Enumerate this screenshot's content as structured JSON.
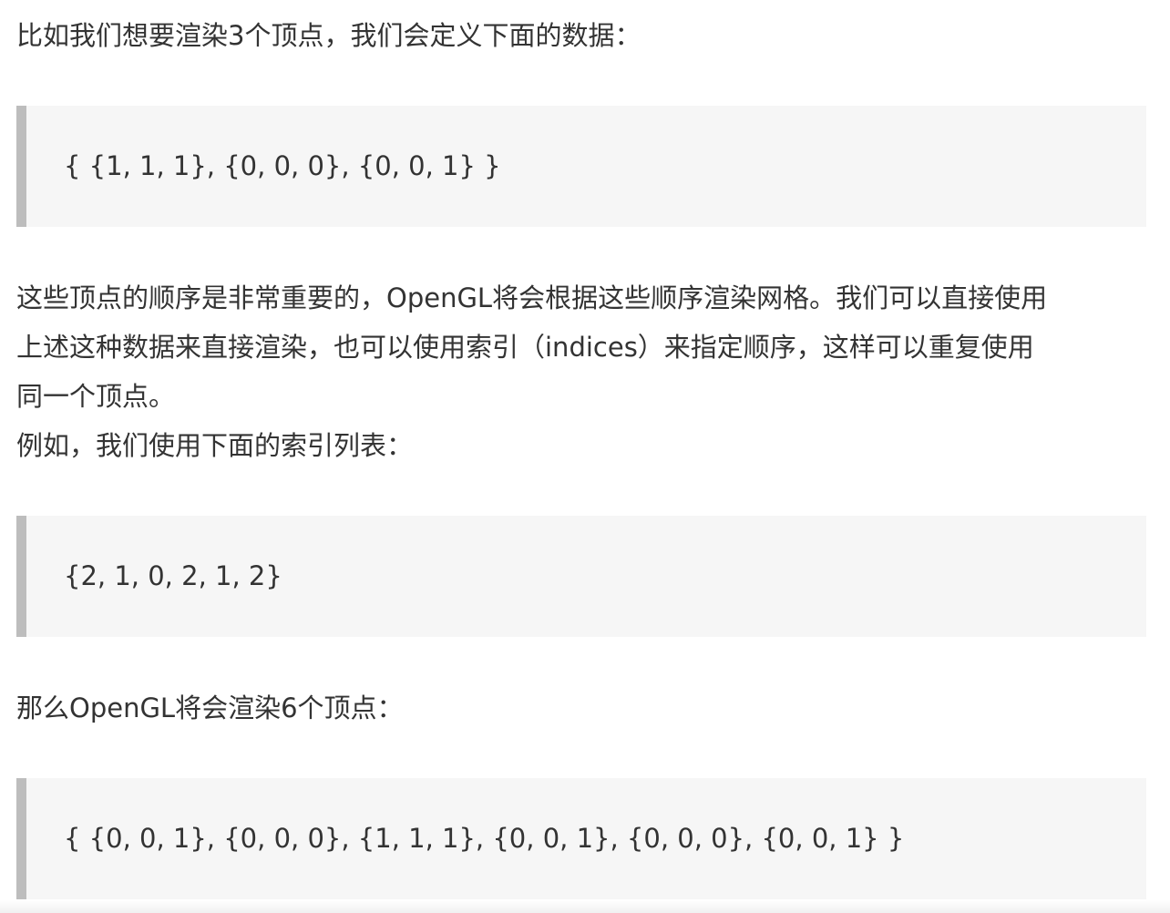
{
  "article": {
    "intro": "比如我们想要渲染3个顶点，我们会定义下面的数据：",
    "vertices_block": "{ {1, 1, 1}, {0, 0, 0}, {0, 0, 1} }",
    "order_lines": [
      "这些顶点的顺序是非常重要的，OpenGL将会根据这些顺序渲染网格。我们可以直接使用",
      "上述这种数据来直接渲染，也可以使用索引（indices）来指定顺序，这样可以重复使用",
      "同一个顶点。",
      "例如，我们使用下面的索引列表："
    ],
    "indices_block": "{2, 1, 0, 2, 1, 2}",
    "result_intro": "那么OpenGL将会渲染6个顶点：",
    "result_block": "{ {0, 0, 1}, {0, 0, 0}, {1, 1, 1}, {0, 0, 1}, {0, 0, 0}, {0, 0, 1} }"
  }
}
